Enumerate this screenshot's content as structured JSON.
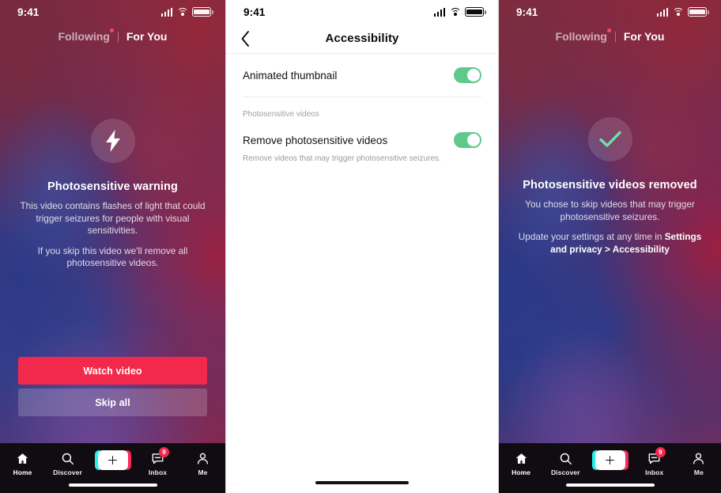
{
  "status_bar": {
    "time": "9:41",
    "icons": [
      "cellular-icon",
      "wifi-icon",
      "battery-icon"
    ]
  },
  "feed_tabs": {
    "following": "Following",
    "for_you": "For You"
  },
  "left_phone": {
    "icon": "lightning-bolt-icon",
    "title": "Photosensitive warning",
    "body_1": "This video contains flashes of light that could trigger seizures for people with visual sensitivities.",
    "body_2": "If you skip this video we'll remove all photosensitive videos.",
    "primary_button": "Watch video",
    "secondary_button": "Skip all"
  },
  "settings_phone": {
    "back_icon": "chevron-left-icon",
    "title": "Accessibility",
    "row_animated_thumbnail": {
      "label": "Animated thumbnail",
      "toggle": "on"
    },
    "section_header": "Photosensitive videos",
    "row_remove_photosensitive": {
      "label": "Remove photosensitive videos",
      "subtitle": "Remove videos that may trigger photosensitive seizures.",
      "toggle": "on"
    }
  },
  "right_phone": {
    "icon": "check-mark-icon",
    "title": "Photosensitive videos removed",
    "body_1": "You chose to skip videos that may trigger photosensitive seizures.",
    "body_2_prefix": "Update your settings at any time in ",
    "body_2_strong": "Settings and privacy > Accessibility"
  },
  "tab_bar": {
    "items": [
      {
        "label": "Home",
        "icon": "home-icon"
      },
      {
        "label": "Discover",
        "icon": "search-icon"
      },
      {
        "label": "",
        "icon": "plus-icon"
      },
      {
        "label": "Inbox",
        "icon": "message-icon",
        "badge": "9"
      },
      {
        "label": "Me",
        "icon": "person-icon"
      }
    ]
  },
  "colors": {
    "accent_red": "#f2294a",
    "toggle_green": "#5fc98c",
    "check_green": "#6ee0a8",
    "tabbar_bg": "#110c11"
  }
}
